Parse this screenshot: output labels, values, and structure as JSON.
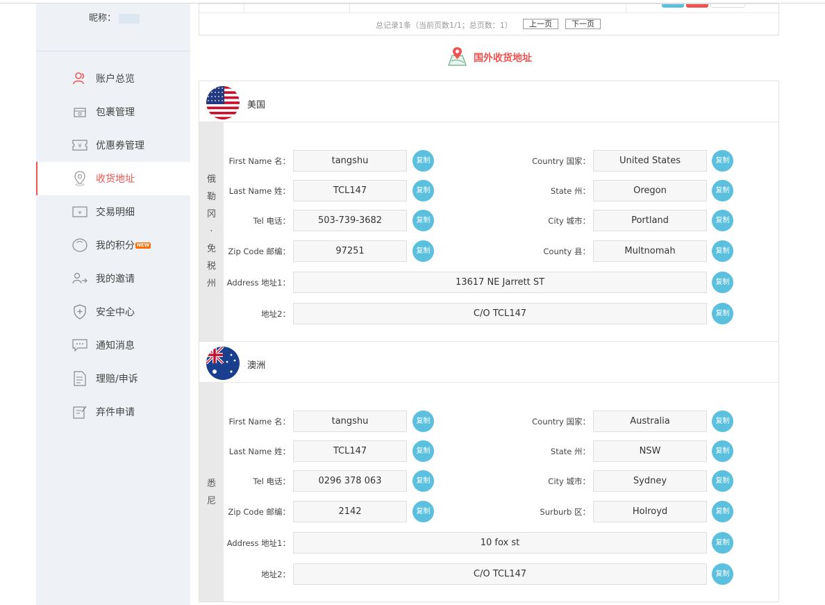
{
  "sidebar": {
    "nickname_label": "昵称：",
    "items": [
      {
        "label": "账户总览",
        "icon": "user-icon"
      },
      {
        "label": "包裹管理",
        "icon": "package-icon"
      },
      {
        "label": "优惠券管理",
        "icon": "coupon-icon"
      },
      {
        "label": "收货地址",
        "icon": "location-pin-icon",
        "active": true
      },
      {
        "label": "交易明细",
        "icon": "transaction-icon"
      },
      {
        "label": "我的积分",
        "icon": "points-icon",
        "badge": "NEW"
      },
      {
        "label": "我的邀请",
        "icon": "invite-icon"
      },
      {
        "label": "安全中心",
        "icon": "shield-icon"
      },
      {
        "label": "通知消息",
        "icon": "message-icon"
      },
      {
        "label": "理赔/申诉",
        "icon": "claim-icon"
      },
      {
        "label": "弃件申请",
        "icon": "abandon-icon"
      }
    ]
  },
  "pager": {
    "summary": "总记录1条（当前页数1/1；总页数：1）",
    "prev_label": "上一页",
    "next_label": "下一页"
  },
  "section_title": "国外收货地址",
  "copy_label": "复制",
  "addresses": [
    {
      "country_name": "美国",
      "flag_icon": "us-flag-icon",
      "side_label": [
        "俄",
        "勒",
        "冈",
        "·",
        "免",
        "税",
        "州"
      ],
      "labels": {
        "first_name": "First Name 名：",
        "last_name": "Last Name 姓：",
        "tel": "Tel 电话：",
        "zip": "Zip Code 邮编：",
        "country": "Country 国家：",
        "state": "State 州：",
        "city": "City 城市：",
        "extra": "County 县：",
        "address1": "Address 地址1：",
        "address2": "地址2："
      },
      "values": {
        "first_name": "tangshu",
        "last_name": "TCL147",
        "tel": "503-739-3682",
        "zip": "97251",
        "country": "United States",
        "state": "Oregon",
        "city": "Portland",
        "extra": "Multnomah",
        "address1": "13617 NE Jarrett ST",
        "address2": "C/O TCL147"
      }
    },
    {
      "country_name": "澳洲",
      "flag_icon": "au-flag-icon",
      "side_label": [
        "悉",
        "尼"
      ],
      "labels": {
        "first_name": "First Name 名：",
        "last_name": "Last Name 姓：",
        "tel": "Tel 电话：",
        "zip": "Zip Code 邮编：",
        "country": "Country 国家：",
        "state": "State 州：",
        "city": "City 城市：",
        "extra": "Surburb 区：",
        "address1": "Address 地址1：",
        "address2": "地址2："
      },
      "values": {
        "first_name": "tangshu",
        "last_name": "TCL147",
        "tel": "0296 378 063",
        "zip": "2142",
        "country": "Australia",
        "state": "NSW",
        "city": "Sydney",
        "extra": "Holroyd",
        "address1": "10 fox st",
        "address2": "C/O TCL147"
      }
    }
  ],
  "colors": {
    "accent": "#ef5350",
    "copy_button": "#5bc0de",
    "sidebar_bg": "#eef2f6"
  }
}
